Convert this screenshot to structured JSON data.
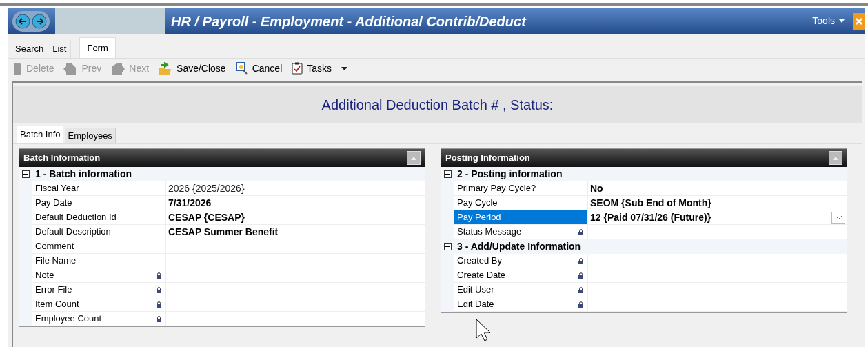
{
  "window": {
    "title": "HR / Payroll - Employment - Additional Contrib/Deduct",
    "menu": "Tools"
  },
  "view_tabs": [
    {
      "label": "Search",
      "selected": false
    },
    {
      "label": "List",
      "selected": false
    },
    {
      "label": "Form",
      "selected": true
    }
  ],
  "toolbar": [
    {
      "kind": "delete",
      "label": "Delete",
      "disabled": true
    },
    {
      "kind": "prev",
      "label": "Prev",
      "disabled": true
    },
    {
      "kind": "next",
      "label": "Next",
      "disabled": true
    },
    {
      "kind": "save",
      "label": "Save/Close",
      "disabled": false
    },
    {
      "kind": "cancel",
      "label": "Cancel",
      "disabled": false
    },
    {
      "kind": "tasks",
      "label": "Tasks",
      "disabled": false
    }
  ],
  "form_title": "Additional Deduction Batch # , Status:",
  "form_tabs": [
    {
      "label": "Batch Info",
      "selected": true
    },
    {
      "label": "Employees",
      "selected": false
    }
  ],
  "panels": [
    {
      "title": "Batch Information",
      "groups": [
        {
          "title": "1 - Batch information",
          "expanded": true,
          "rows": [
            {
              "label": "Fiscal Year",
              "value": "2026 {2025/2026}",
              "modified": false,
              "locked": false,
              "selected": false
            },
            {
              "label": "Pay Date",
              "value": "7/31/2026",
              "modified": true,
              "locked": false,
              "selected": false
            },
            {
              "label": "Default Deduction Id",
              "value": "CESAP {CESAP}",
              "modified": true,
              "locked": false,
              "selected": false
            },
            {
              "label": "Default Description",
              "value": "CESAP Summer Benefit",
              "modified": true,
              "locked": false,
              "selected": false
            },
            {
              "label": "Comment",
              "locked": false,
              "selected": false
            },
            {
              "label": "File Name",
              "locked": false,
              "selected": false
            },
            {
              "label": "Note",
              "locked": true,
              "selected": false
            },
            {
              "label": "Error File",
              "locked": true,
              "selected": false
            },
            {
              "label": "Item Count",
              "locked": true,
              "selected": false
            },
            {
              "label": "Employee Count",
              "locked": true,
              "selected": false
            }
          ]
        }
      ]
    },
    {
      "title": "Posting Information",
      "groups": [
        {
          "title": "2 - Posting information",
          "expanded": true,
          "rows": [
            {
              "label": "Primary Pay Cycle?",
              "value": "No",
              "modified": true,
              "locked": false,
              "selected": false
            },
            {
              "label": "Pay Cycle",
              "value": "SEOM {Sub End of Month}",
              "modified": true,
              "locked": false,
              "selected": false
            },
            {
              "label": "Pay Period",
              "value": "12 {Paid 07/31/26 (Future)}",
              "modified": true,
              "locked": false,
              "selected": true
            },
            {
              "label": "Status Message",
              "locked": true,
              "selected": false
            }
          ]
        },
        {
          "title": "3 - Add/Update Information",
          "expanded": true,
          "rows": [
            {
              "label": "Created By",
              "locked": true,
              "selected": false
            },
            {
              "label": "Create Date",
              "locked": true,
              "selected": false
            },
            {
              "label": "Edit User",
              "locked": true,
              "selected": false
            },
            {
              "label": "Edit Date",
              "locked": true,
              "selected": false
            }
          ]
        }
      ]
    }
  ]
}
